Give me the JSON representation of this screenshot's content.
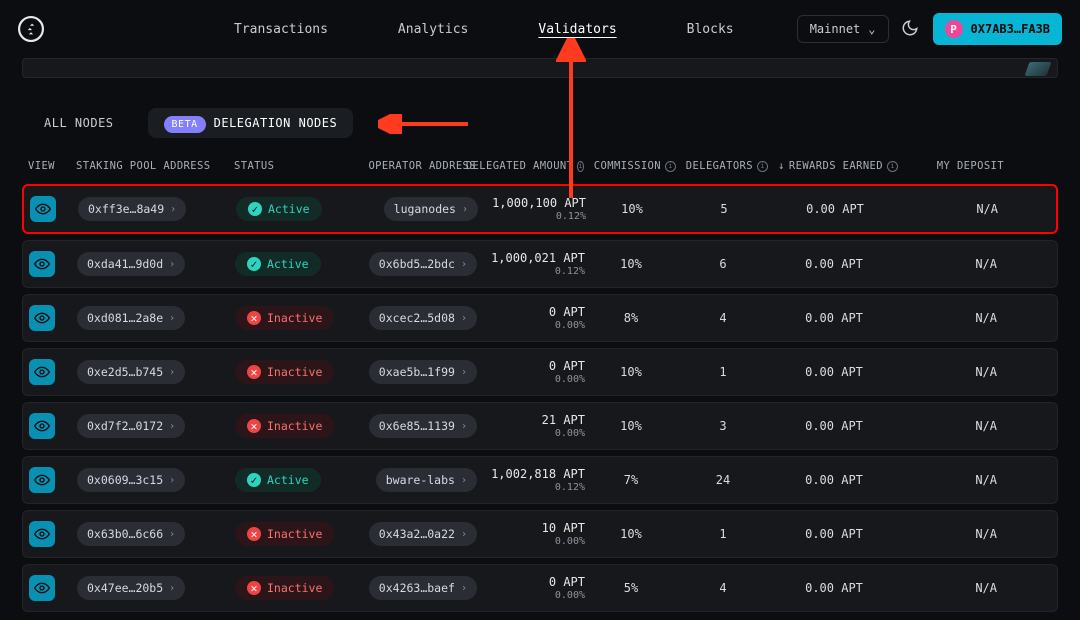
{
  "nav": {
    "items": [
      "Transactions",
      "Analytics",
      "Validators",
      "Blocks"
    ],
    "active_index": 2
  },
  "network": {
    "label": "Mainnet"
  },
  "wallet": {
    "address": "0X7AB3…FA3B",
    "avatar_letter": "P"
  },
  "tabs": {
    "all": "ALL NODES",
    "delegation": "DELEGATION NODES",
    "beta": "BETA",
    "active_index": 1
  },
  "columns": {
    "view": "VIEW",
    "pool": "STAKING POOL ADDRESS",
    "status": "STATUS",
    "operator": "OPERATOR ADDRESS",
    "delegated": "DELEGATED AMOUNT",
    "commission": "COMMISSION",
    "delegators": "DELEGATORS",
    "rewards": "REWARDS EARNED",
    "deposit": "MY DEPOSIT",
    "sort_arrow": "↓"
  },
  "status_labels": {
    "active": "Active",
    "inactive": "Inactive"
  },
  "rows": [
    {
      "pool": "0xff3e…8a49",
      "status": "active",
      "operator": "luganodes",
      "amount": "1,000,100 APT",
      "pct": "0.12%",
      "commission": "10%",
      "delegators": "5",
      "rewards": "0.00 APT",
      "deposit": "N/A",
      "highlight": true
    },
    {
      "pool": "0xda41…9d0d",
      "status": "active",
      "operator": "0x6bd5…2bdc",
      "amount": "1,000,021 APT",
      "pct": "0.12%",
      "commission": "10%",
      "delegators": "6",
      "rewards": "0.00 APT",
      "deposit": "N/A"
    },
    {
      "pool": "0xd081…2a8e",
      "status": "inactive",
      "operator": "0xcec2…5d08",
      "amount": "0 APT",
      "pct": "0.00%",
      "commission": "8%",
      "delegators": "4",
      "rewards": "0.00 APT",
      "deposit": "N/A"
    },
    {
      "pool": "0xe2d5…b745",
      "status": "inactive",
      "operator": "0xae5b…1f99",
      "amount": "0 APT",
      "pct": "0.00%",
      "commission": "10%",
      "delegators": "1",
      "rewards": "0.00 APT",
      "deposit": "N/A"
    },
    {
      "pool": "0xd7f2…0172",
      "status": "inactive",
      "operator": "0x6e85…1139",
      "amount": "21 APT",
      "pct": "0.00%",
      "commission": "10%",
      "delegators": "3",
      "rewards": "0.00 APT",
      "deposit": "N/A"
    },
    {
      "pool": "0x0609…3c15",
      "status": "active",
      "operator": "bware-labs",
      "amount": "1,002,818 APT",
      "pct": "0.12%",
      "commission": "7%",
      "delegators": "24",
      "rewards": "0.00 APT",
      "deposit": "N/A"
    },
    {
      "pool": "0x63b0…6c66",
      "status": "inactive",
      "operator": "0x43a2…0a22",
      "amount": "10 APT",
      "pct": "0.00%",
      "commission": "10%",
      "delegators": "1",
      "rewards": "0.00 APT",
      "deposit": "N/A"
    },
    {
      "pool": "0x47ee…20b5",
      "status": "inactive",
      "operator": "0x4263…baef",
      "amount": "0 APT",
      "pct": "0.00%",
      "commission": "5%",
      "delegators": "4",
      "rewards": "0.00 APT",
      "deposit": "N/A"
    }
  ],
  "colors": {
    "accent": "#06b6d4",
    "highlight": "#ff0000"
  }
}
